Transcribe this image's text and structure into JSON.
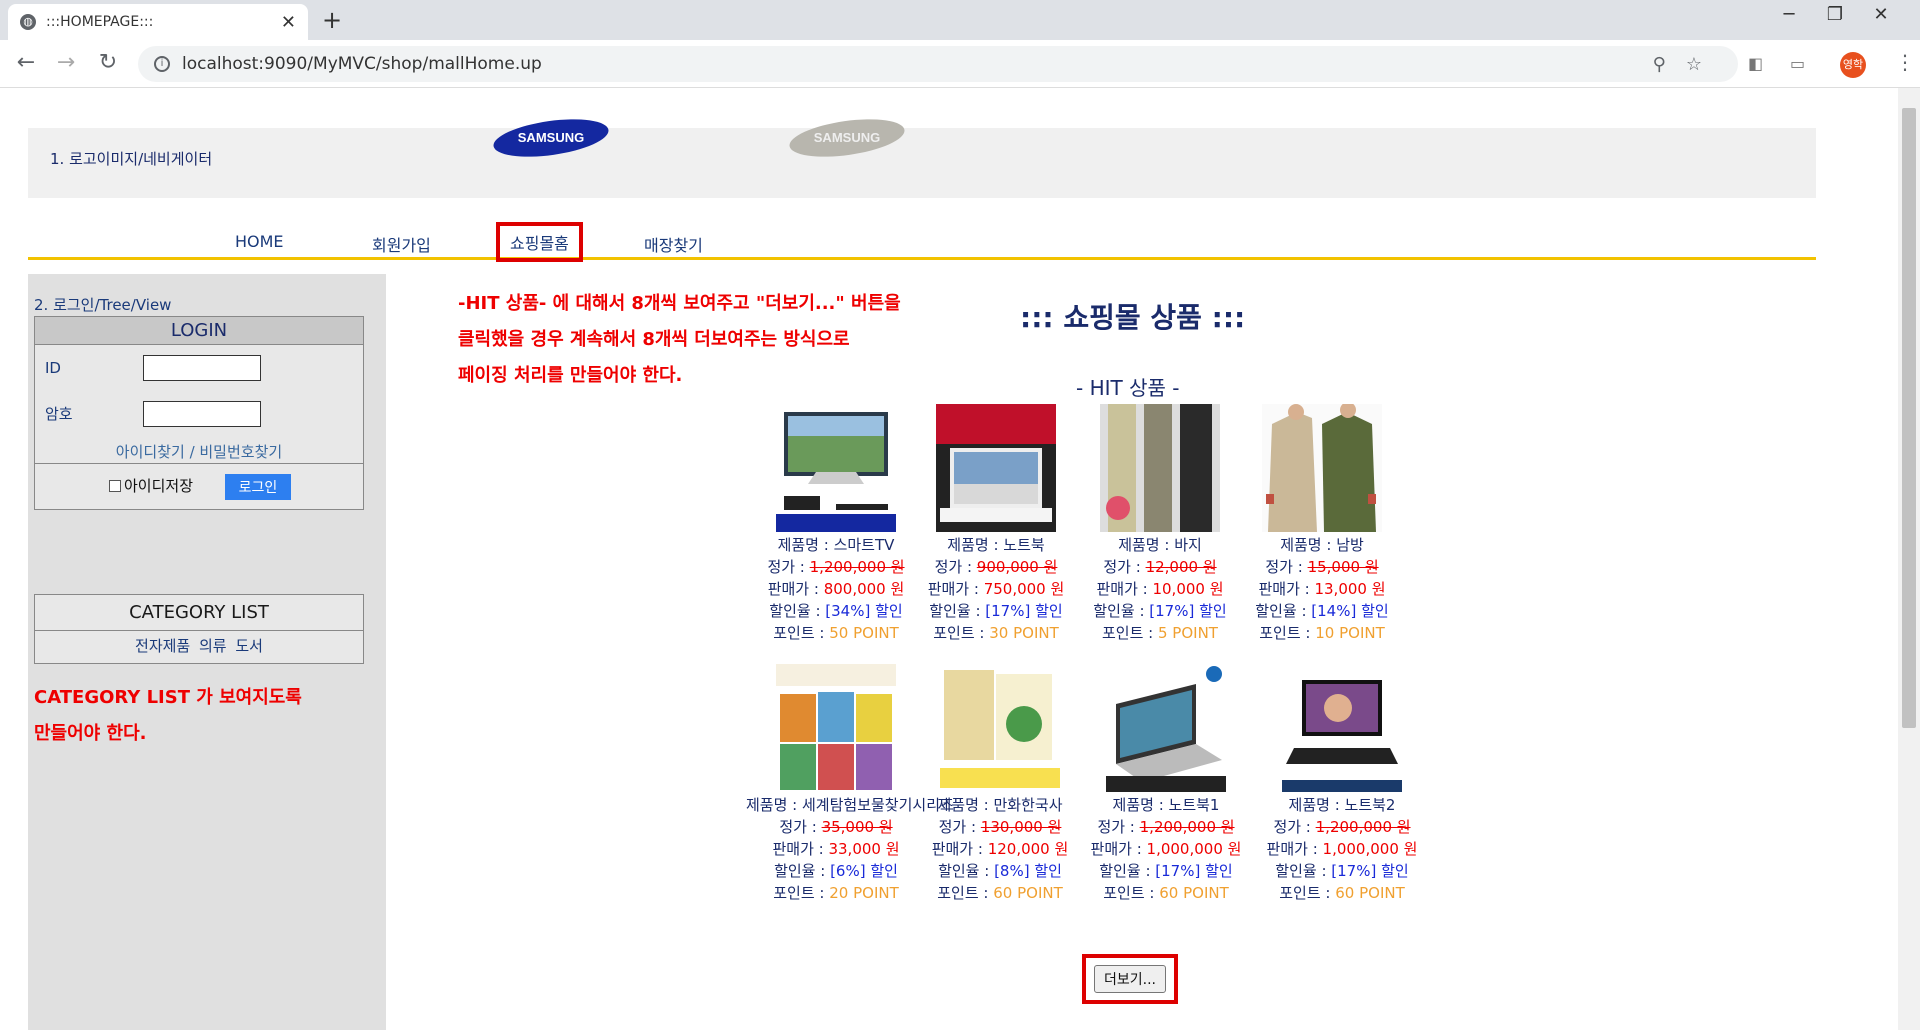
{
  "browser": {
    "tab_title": ":::HOMEPAGE:::",
    "url": "localhost:9090/MyMVC/shop/mallHome.up",
    "profile_initials": "영학"
  },
  "header": {
    "section_label": "1. 로고이미지/네비게이터",
    "logo_text": "SAMSUNG"
  },
  "nav": {
    "items": [
      "HOME",
      "회원가입",
      "쇼핑몰홈",
      "매장찾기"
    ]
  },
  "sidebar": {
    "section_label": "2. 로그인/Tree/View",
    "login": {
      "title": "LOGIN",
      "id_label": "ID",
      "pw_label": "암호",
      "find_link": "아이디찾기 / 비밀번호찾기",
      "save_id_label": "아이디저장",
      "login_button": "로그인"
    },
    "category": {
      "title": "CATEGORY LIST",
      "items": "전자제품  의류  도서"
    },
    "note_line1": "CATEGORY LIST 가 보여지도록",
    "note_line2": "만들어야 한다."
  },
  "main": {
    "note_line1": "-HIT 상품- 에 대해서 8개씩 보여주고 \"더보기...\" 버튼을",
    "note_line2": "클릭했을 경우 계속해서 8개씩 더보여주는 방식으로",
    "note_line3": "페이징 처리를 만들어야 한다.",
    "title": "::: 쇼핑몰 상품 :::",
    "hit_label": "- HIT 상품 -",
    "more_button": "더보기...",
    "products": [
      {
        "name": "제품명 : 스마트TV",
        "price_label": "정가 : ",
        "price": "1,200,000 원",
        "sale_label": "판매가 : ",
        "sale": "800,000 원",
        "disc_label": "할인율 : ",
        "disc": "[34%] 할인",
        "point_label": "포인트 : ",
        "point": "50 POINT",
        "img": "tv"
      },
      {
        "name": "제품명 : 노트북",
        "price_label": "정가 : ",
        "price": "900,000 원",
        "sale_label": "판매가 : ",
        "sale": "750,000 원",
        "disc_label": "할인율 : ",
        "disc": "[17%] 할인",
        "point_label": "포인트 : ",
        "point": "30 POINT",
        "img": "laptop-lg"
      },
      {
        "name": "제품명 : 바지",
        "price_label": "정가 : ",
        "price": "12,000 원",
        "sale_label": "판매가 : ",
        "sale": "10,000 원",
        "disc_label": "할인율 : ",
        "disc": "[17%] 할인",
        "point_label": "포인트 : ",
        "point": "5 POINT",
        "img": "pants"
      },
      {
        "name": "제품명 : 남방",
        "price_label": "정가 : ",
        "price": "15,000 원",
        "sale_label": "판매가 : ",
        "sale": "13,000 원",
        "disc_label": "할인율 : ",
        "disc": "[14%] 할인",
        "point_label": "포인트 : ",
        "point": "10 POINT",
        "img": "shirt"
      },
      {
        "name": "제품명 : 세계탐험보물찾기시리즈",
        "price_label": "정가 : ",
        "price": "35,000 원",
        "sale_label": "판매가 : ",
        "sale": "33,000 원",
        "disc_label": "할인율 : ",
        "disc": "[6%] 할인",
        "point_label": "포인트 : ",
        "point": "20 POINT",
        "img": "books1"
      },
      {
        "name": "제품명 : 만화한국사",
        "price_label": "정가 : ",
        "price": "130,000 원",
        "sale_label": "판매가 : ",
        "sale": "120,000 원",
        "disc_label": "할인율 : ",
        "disc": "[8%] 할인",
        "point_label": "포인트 : ",
        "point": "60 POINT",
        "img": "books2"
      },
      {
        "name": "제품명 : 노트북1",
        "price_label": "정가 : ",
        "price": "1,200,000 원",
        "sale_label": "판매가 : ",
        "sale": "1,000,000 원",
        "disc_label": "할인율 : ",
        "disc": "[17%] 할인",
        "point_label": "포인트 : ",
        "point": "60 POINT",
        "img": "laptop-dell"
      },
      {
        "name": "제품명 : 노트북2",
        "price_label": "정가 : ",
        "price": "1,200,000 원",
        "sale_label": "판매가 : ",
        "sale": "1,000,000 원",
        "disc_label": "할인율 : ",
        "disc": "[17%] 할인",
        "point_label": "포인트 : ",
        "point": "60 POINT",
        "img": "laptop-acer"
      }
    ]
  }
}
